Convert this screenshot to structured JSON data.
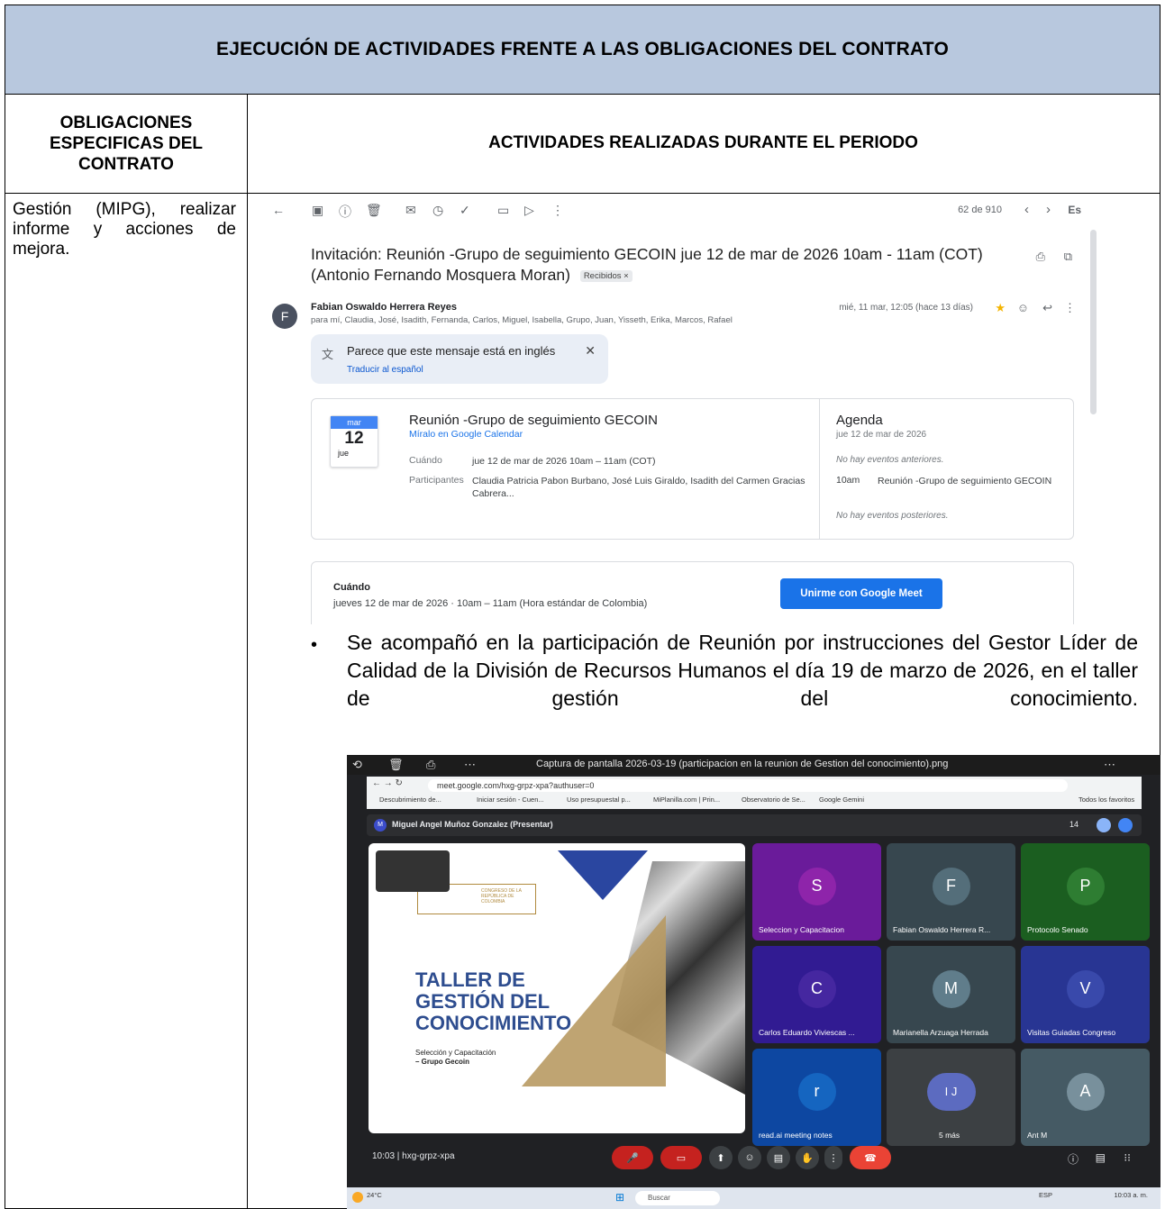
{
  "document": {
    "title": "EJECUCIÓN DE ACTIVIDADES FRENTE A LAS OBLIGACIONES DEL CONTRATO",
    "col_left_header": "OBLIGACIONES ESPECIFICAS DEL CONTRATO",
    "col_right_header": "ACTIVIDADES REALIZADAS DURANTE EL PERIODO",
    "left_cell_text": "Gestión (MIPG), realizar informe y acciones de mejora.",
    "bullet_text": "Se acompañó en la participación de Reunión por instrucciones del Gestor Líder de Calidad de la División de Recursos Humanos el día 19 de marzo de 2026, en el taller de gestión del conocimiento."
  },
  "gmail": {
    "message_count": "62 de 910",
    "lang": "Es",
    "subject": "Invitación: Reunión -Grupo de seguimiento GECOIN jue 12 de mar de 2026 10am - 11am (COT) (Antonio Fernando Mosquera Moran)",
    "label_chip": "Recibidos ×",
    "sender_initial": "F",
    "sender": "Fabian Oswaldo Herrera Reyes",
    "recipients": "para mí, Claudia, José, Isadith, Fernanda, Carlos, Miguel, Isabella, Grupo, Juan, Yisseth, Erika, Marcos, Rafael",
    "date": "mié, 11 mar, 12:05 (hace 13 días)",
    "translate_msg": "Parece que este mensaje está en inglés",
    "translate_link": "Traducir al español",
    "cal_month": "mar",
    "cal_day": "12",
    "cal_weekday": "jue",
    "event_title": "Reunión -Grupo de seguimiento GECOIN",
    "event_link": "Míralo en Google Calendar",
    "when_label": "Cuándo",
    "when_value": "jue 12 de mar de 2026 10am – 11am (COT)",
    "participants_label": "Participantes",
    "participants_value": "Claudia Patricia Pabon Burbano, José Luis Giraldo, Isadith del Carmen Gracias Cabrera...",
    "agenda_title": "Agenda",
    "agenda_date": "jue 12 de mar de 2026",
    "agenda_prev": "No hay eventos anteriores.",
    "agenda_time": "10am",
    "agenda_event": "Reunión -Grupo de seguimiento GECOIN",
    "agenda_next": "No hay eventos posteriores.",
    "when_box_label": "Cuándo",
    "when_box_value": "jueves 12 de mar de 2026 · 10am – 11am (Hora estándar de Colombia)",
    "meet_button": "Unirme con Google Meet"
  },
  "meet": {
    "window_title": "Captura de pantalla 2026-03-19 (participacion en la reunion de Gestion del conocimiento).png",
    "url": "meet.google.com/hxg-grpz-xpa?authuser=0",
    "bookmarks": [
      "Descubrimiento de...",
      "Iniciar sesión - Cuen...",
      "Uso presupuestal p...",
      "MiPlanilla.com | Prin...",
      "Observatorio de Se...",
      "Google Gemini",
      "Todos los favoritos"
    ],
    "presenter": "Miguel Angel Muñoz Gonzalez (Presentar)",
    "participant_count": "14",
    "slide_title": "TALLER DE GESTIÓN DEL CONOCIMIENTO",
    "slide_logo_text": "CONGRESO DE LA REPÚBLICA DE COLOMBIA",
    "slide_sub1": "Selección y Capacitación",
    "slide_sub2": "– Grupo Gecoin",
    "tiles": [
      {
        "initial": "S",
        "name": "Seleccion y Capacitacion",
        "color": "#7b1fa2"
      },
      {
        "initial": "F",
        "name": "Fabian Oswaldo Herrera R...",
        "color": "#455a64"
      },
      {
        "initial": "P",
        "name": "Protocolo Senado",
        "color": "#2e7d32"
      },
      {
        "initial": "C",
        "name": "Carlos Eduardo Viviescas ...",
        "color": "#4527a0"
      },
      {
        "initial": "M",
        "name": "Marianella Arzuaga Herrada",
        "color": "#546e7a"
      },
      {
        "initial": "V",
        "name": "Visitas Guiadas Congreso",
        "color": "#3949ab"
      },
      {
        "initial": "r",
        "name": "read.ai meeting notes",
        "color": "#1565c0"
      },
      {
        "initial": "I J",
        "name": "5 más",
        "color": "#3c4043"
      },
      {
        "initial": "A",
        "name": "Ant M",
        "color": "#607d8b"
      }
    ],
    "time_code": "10:03 | hxg-grpz-xpa",
    "temperature": "24°C",
    "taskbar_search": "Buscar",
    "taskbar_lang": "ESP",
    "taskbar_time": "10:03 a. m."
  }
}
